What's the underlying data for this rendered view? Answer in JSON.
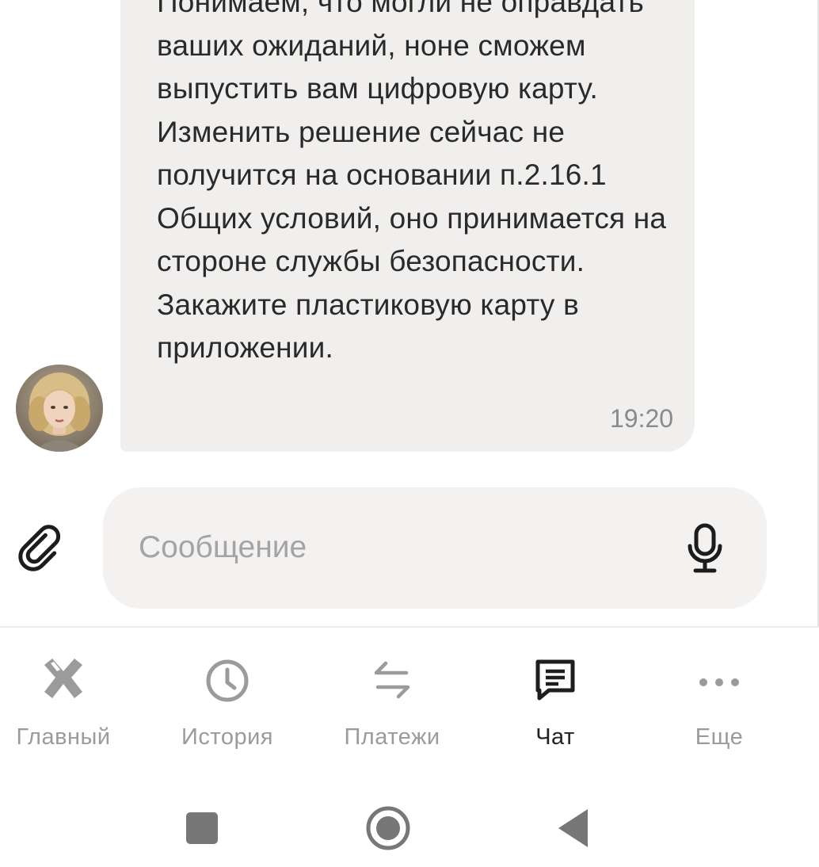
{
  "chat": {
    "message_text": "Понимаем, что могли не оправдать ваших ожиданий, ноне сможем выпустить вам цифровую карту. Изменить решение сейчас не получится на основании п.2.16.1 Общих условий, оно принимается на стороне службы безопасности. Закажите пластиковую карту в приложении.",
    "time": "19:20"
  },
  "composer": {
    "placeholder": "Сообщение",
    "value": ""
  },
  "nav": {
    "items": [
      {
        "label": "Главный",
        "icon": "bank-logo-icon",
        "active": false
      },
      {
        "label": "История",
        "icon": "clock-icon",
        "active": false
      },
      {
        "label": "Платежи",
        "icon": "transfer-arrows-icon",
        "active": false
      },
      {
        "label": "Чат",
        "icon": "chat-icon",
        "active": true
      },
      {
        "label": "Еще",
        "icon": "more-dots-icon",
        "active": false
      }
    ]
  },
  "system_nav": {
    "buttons": [
      "recents-square-icon",
      "home-circle-icon",
      "back-triangle-icon"
    ]
  },
  "colors": {
    "bubble": "#f0efee",
    "inactive": "#9b9b9b",
    "active": "#222222",
    "background": "#ffffff"
  }
}
